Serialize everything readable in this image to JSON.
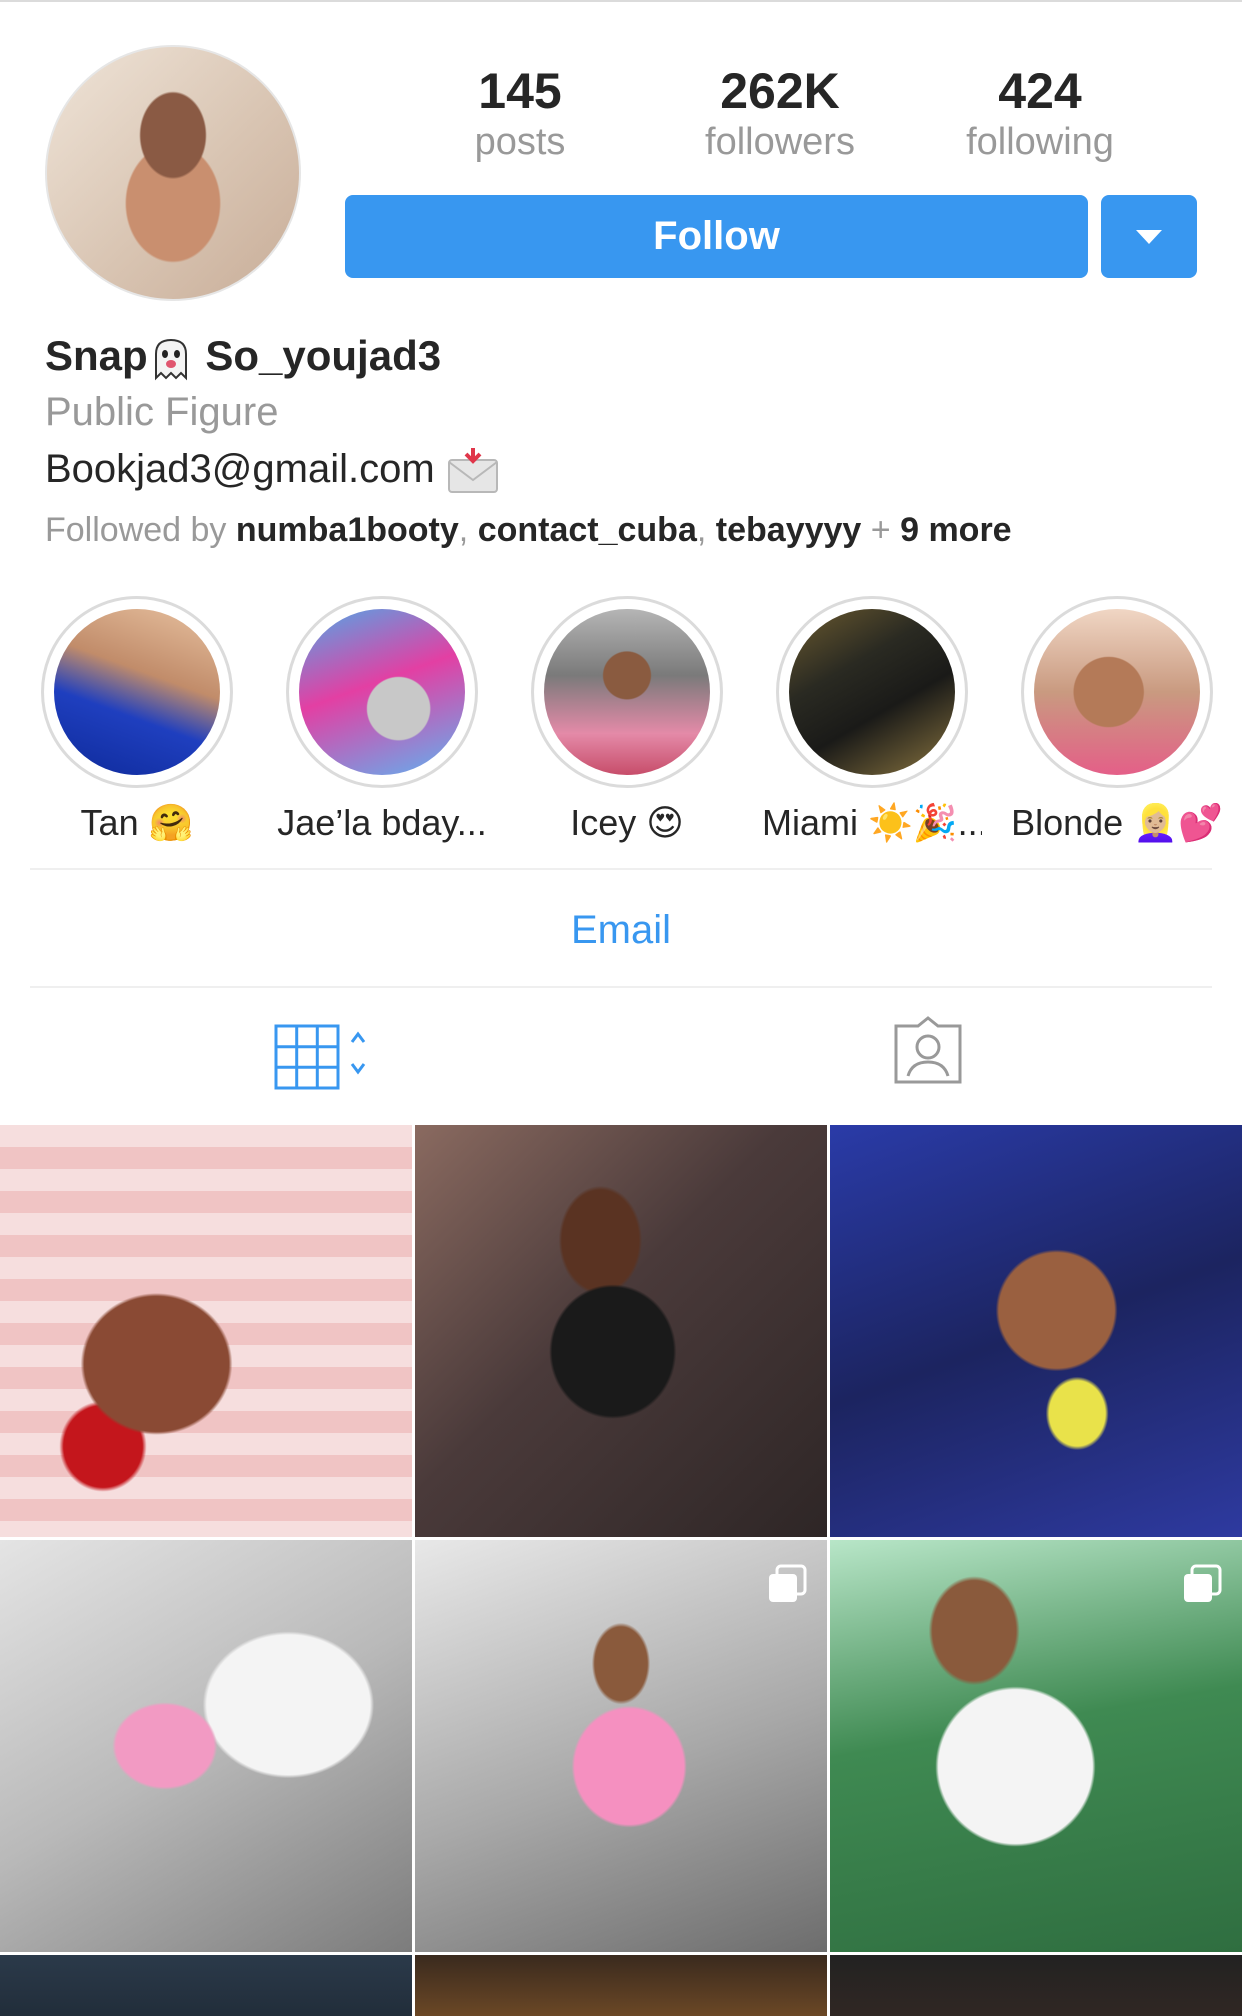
{
  "profile": {
    "stats": [
      {
        "value": "145",
        "label": "posts"
      },
      {
        "value": "262K",
        "label": "followers"
      },
      {
        "value": "424",
        "label": "following"
      }
    ],
    "follow_label": "Follow",
    "name_prefix": "Snap",
    "name_suffix": "So_youjad3",
    "category": "Public Figure",
    "email_text": "Bookjad3@gmail.com",
    "followed_by_prefix": "Followed by",
    "followed_by_users": [
      "numba1booty",
      "contact_cuba",
      "tebayyyy"
    ],
    "followed_by_more": "9 more"
  },
  "highlights": [
    {
      "label": "Tan",
      "emoji": "🤗"
    },
    {
      "label": "Jae’la bday...",
      "emoji": ""
    },
    {
      "label": "Icey",
      "emoji": "😍"
    },
    {
      "label": "Miami",
      "emoji": "☀️🎉..."
    },
    {
      "label": "Blonde",
      "emoji": "👱🏼‍♀️💕"
    }
  ],
  "actions": {
    "email_label": "Email"
  },
  "icons": {
    "ghost": "ghost-icon",
    "envelope": "incoming-envelope-icon",
    "grid": "grid-view-icon",
    "tagged": "tagged-photos-icon",
    "multi": "multiple-photos-icon"
  },
  "colors": {
    "accent": "#3897f0",
    "muted": "#999999",
    "text": "#262626"
  }
}
